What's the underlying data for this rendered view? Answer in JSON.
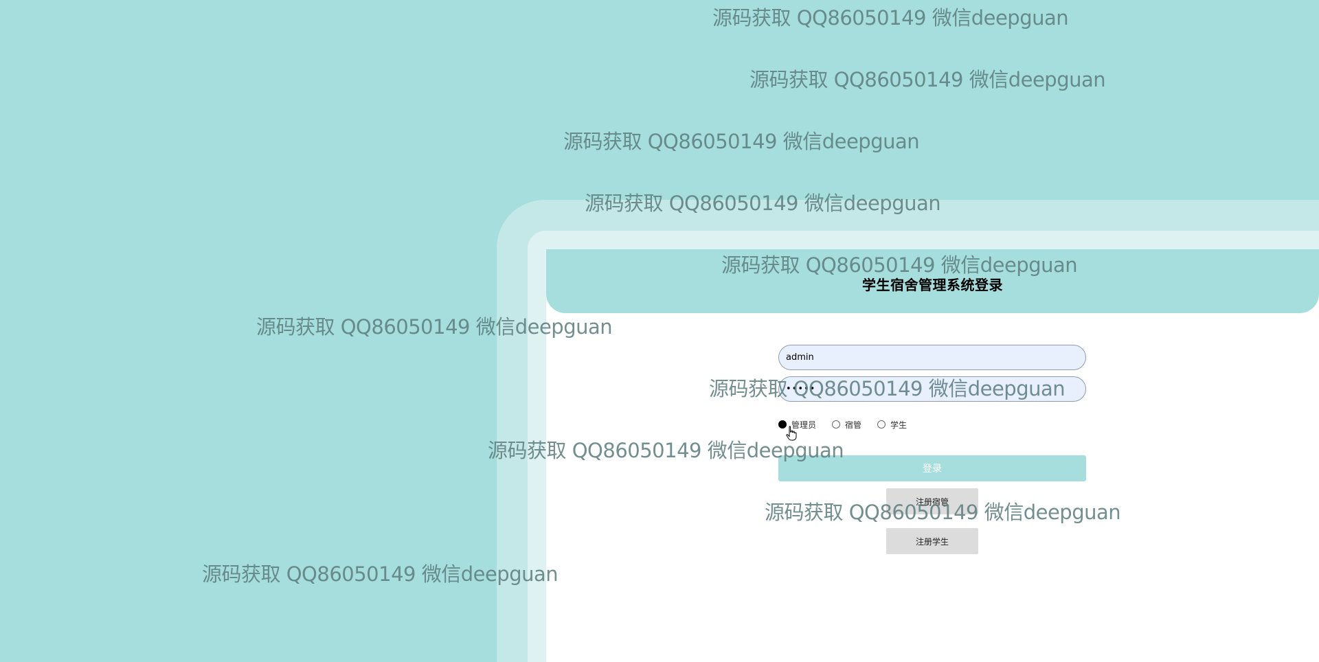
{
  "login": {
    "title": "学生宿舍管理系统登录",
    "username_value": "admin",
    "password_value": "•••••",
    "roles": [
      "管理员",
      "宿管",
      "学生"
    ],
    "selected_role": "管理员",
    "login_label": "登录",
    "register_dorm_label": "注册宿管",
    "register_student_label": "注册学生"
  },
  "watermark": {
    "text": "源码获取 QQ86050149 微信deepguan"
  },
  "colors": {
    "background": "#a6dedd",
    "frame_outer": "#c4e8e7",
    "frame_inner": "#ddf2f1",
    "panel": "#ffffff",
    "accent": "#a6dedd",
    "secondary_button": "#dcdcdc"
  },
  "icons": {
    "cursor": "hand-pointer-icon"
  }
}
